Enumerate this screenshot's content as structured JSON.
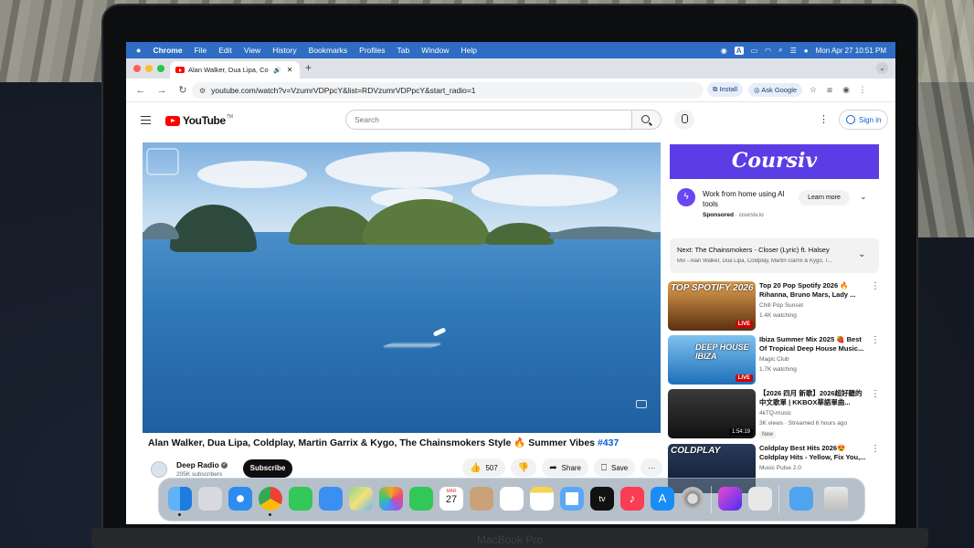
{
  "menubar": {
    "apple": "",
    "items": [
      "Chrome",
      "File",
      "Edit",
      "View",
      "History",
      "Bookmarks",
      "Profiles",
      "Tab",
      "Window",
      "Help"
    ],
    "input_indicator": "A",
    "datetime": "Mon Apr 27  10:51 PM"
  },
  "browser": {
    "tab_title": "Alan Walker, Dua Lipa, Co",
    "new_tab": "+",
    "url": "youtube.com/watch?v=VzumrVDPpcY&list=RDVzumrVDPpcY&start_radio=1",
    "install_label": "Install",
    "ask_google_label": "Ask Google"
  },
  "youtube": {
    "logo_text": "YouTube",
    "logo_tm": "TM",
    "search_placeholder": "Search",
    "sign_in": "Sign in"
  },
  "video": {
    "title": "Alan Walker, Dua Lipa, Coldplay, Martin Garrix & Kygo, The Chainsmokers Style 🔥 Summer Vibes",
    "hashtag": "#437",
    "channel": "Deep Radio",
    "subscribers": "205K subscribers",
    "subscribe_label": "Subscribe",
    "likes": "507",
    "share_label": "Share",
    "save_label": "Save",
    "more_label": "···"
  },
  "ad": {
    "brand": "Coursiv",
    "text": "Work from home using AI tools",
    "sponsored": "Sponsored",
    "domain": "· coursiv.io",
    "cta": "Learn more"
  },
  "up_next": {
    "title": "Next: The Chainsmokers - Closer (Lyric) ft. Halsey",
    "subtitle": "Mix - Alan Walker, Dua Lipa, Coldplay, Martin Garrix & Kygo, T..."
  },
  "recommendations": [
    {
      "thumb_text": "TOP SPOTIFY 2026",
      "title": "Top 20 Pop Spotify 2026 🔥 Rihanna, Bruno Mars, Lady ...",
      "channel": "Chill Pop Sunset",
      "meta": "1.4K watching",
      "badge": "LIVE",
      "thumb_color": "#8a5a2a"
    },
    {
      "thumb_text": "DEEP HOUSE IBIZA",
      "title": "Ibiza Summer Mix 2025 🍓 Best Of Tropical Deep House Music...",
      "channel": "Magic Club",
      "meta": "1.7K watching",
      "badge": "LIVE",
      "thumb_color": "#3b8fd6"
    },
    {
      "thumb_text": "",
      "title": "【2026 四月 新歌】2026超好聽的中文歌單 | KKBOX華語單曲...",
      "channel": "4kTQ-music",
      "meta": "3K views · Streamed 6 hours ago",
      "badge": "1:54:19",
      "new_label": "New",
      "thumb_color": "#2a2a2a"
    },
    {
      "thumb_text": "COLDPLAY",
      "title": "Coldplay Best Hits 2026😍 Coldplay Hits - Yellow, Fix You,...",
      "channel": "Music Pulse 2.0",
      "meta": "",
      "badge": "",
      "thumb_color": "#1b2a44"
    }
  ],
  "dock": {
    "apps": [
      "Finder",
      "Launchpad",
      "Safari",
      "Chrome",
      "Messages",
      "Mail",
      "Maps",
      "Photos",
      "FaceTime",
      "Calendar",
      "Contacts",
      "Reminders",
      "Notes",
      "Freeform",
      "TV",
      "Music",
      "App Store",
      "System Settings",
      "Shortcuts",
      "Preview",
      "Downloads",
      "Trash"
    ],
    "calendar_month": "MAR",
    "calendar_day": "27",
    "tv_label": "tv"
  },
  "device": {
    "label": "MacBook Pro"
  },
  "colors": {
    "menubar": "#2f6dc4",
    "youtube_red": "#ff0000",
    "ad_purple": "#5b3de6",
    "link_blue": "#065fd4"
  }
}
